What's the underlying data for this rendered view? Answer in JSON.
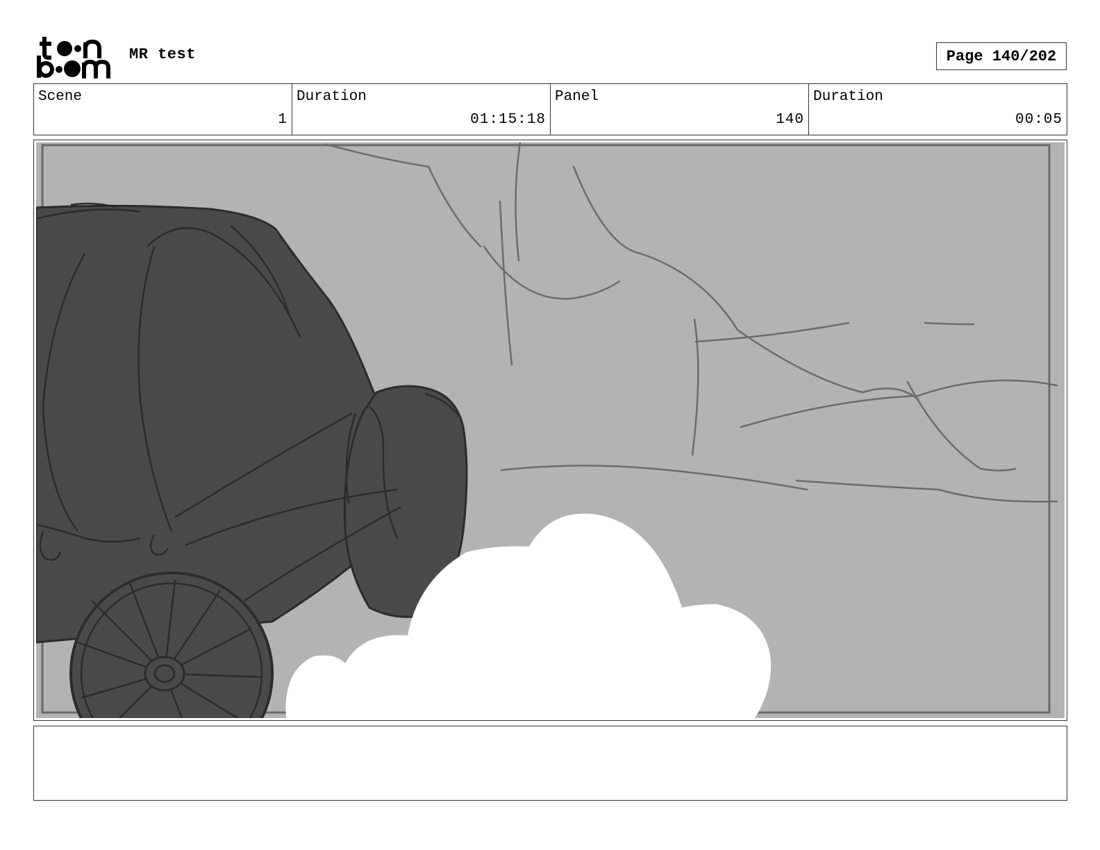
{
  "header": {
    "logo_text": "toon boom",
    "project_title": "MR test",
    "page_indicator": "Page 140/202"
  },
  "info": {
    "scene_label": "Scene",
    "scene_value": "1",
    "scene_duration_label": "Duration",
    "scene_duration_value": "01:15:18",
    "panel_label": "Panel",
    "panel_value": "140",
    "panel_duration_label": "Duration",
    "panel_duration_value": "00:05"
  },
  "panel": {
    "description": "",
    "colors": {
      "background": "#b3b3b3",
      "cannon": "#4a4a4a",
      "smoke": "#ffffff",
      "lines": "#2b2b2b"
    }
  },
  "notes": {
    "text": ""
  }
}
